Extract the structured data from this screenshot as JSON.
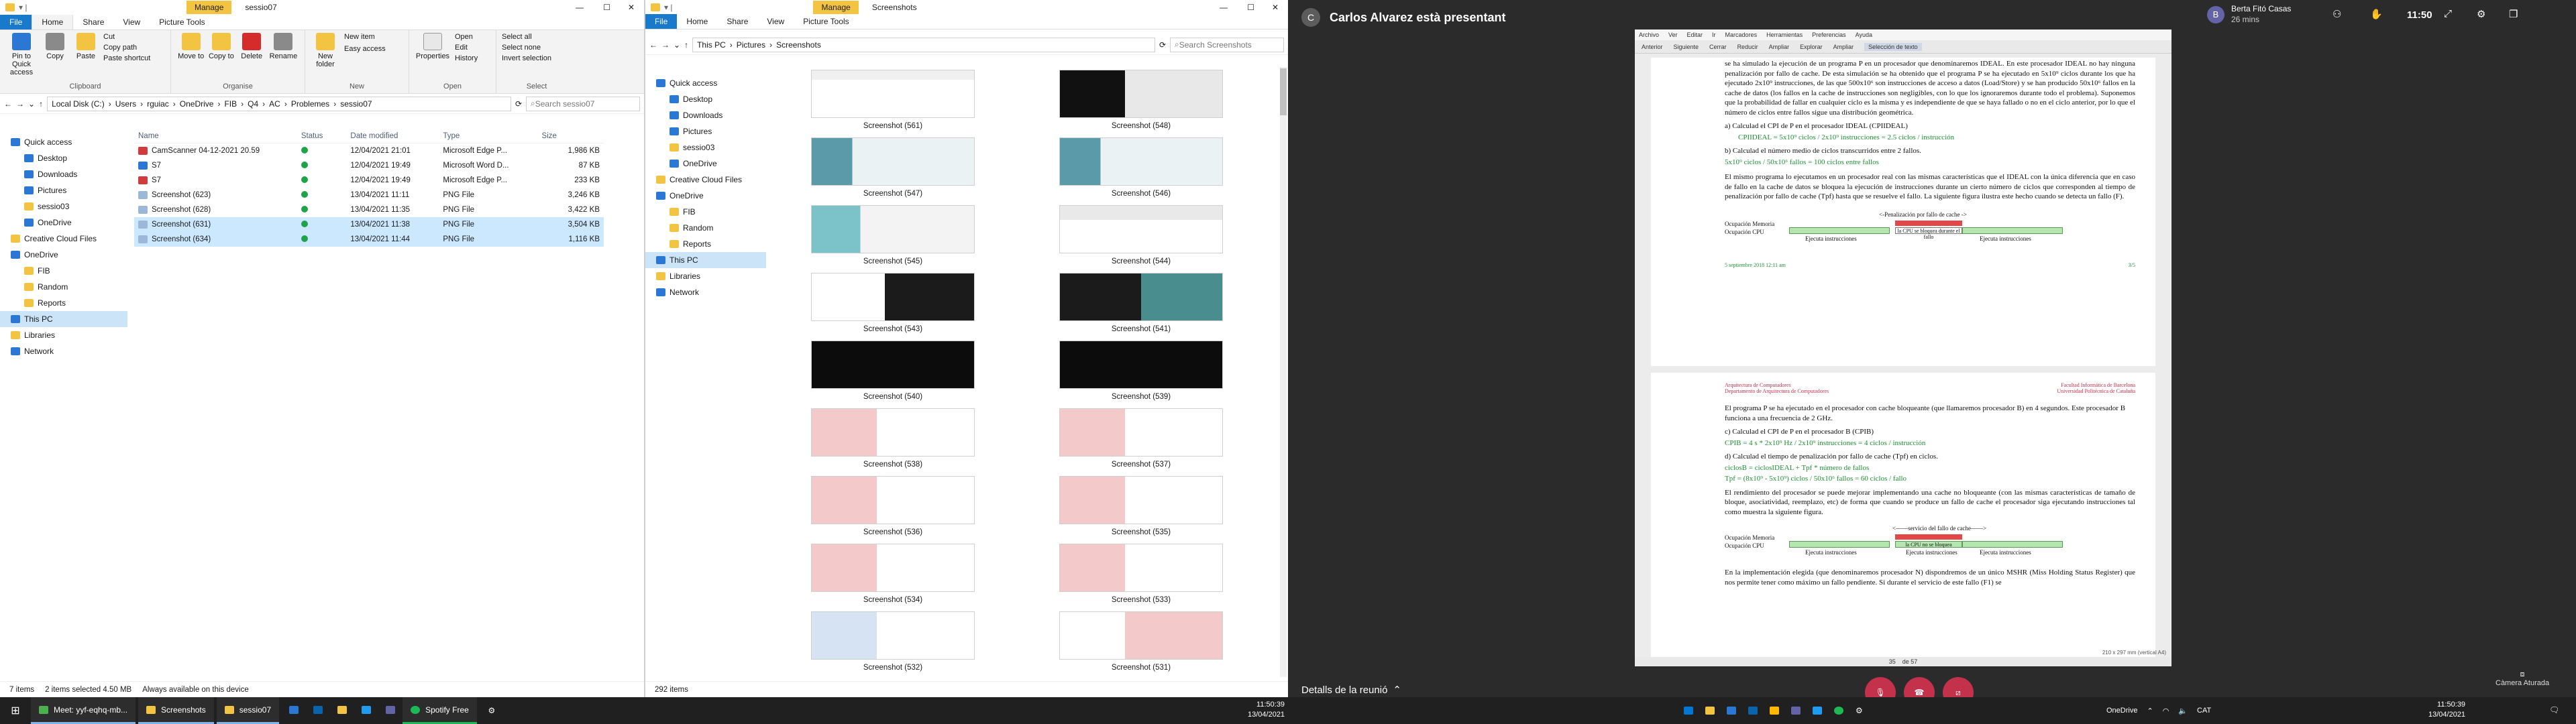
{
  "left_explorer": {
    "title": "sessio07",
    "manage_tab": "Manage",
    "tabs": [
      "File",
      "Home",
      "Share",
      "View",
      "Picture Tools"
    ],
    "ribbon": {
      "pin": "Pin to Quick access",
      "copy": "Copy",
      "paste": "Paste",
      "cut": "Cut",
      "copy_path": "Copy path",
      "paste_shortcut": "Paste shortcut",
      "move_to": "Move to",
      "copy_to": "Copy to",
      "delete": "Delete",
      "rename": "Rename",
      "new_folder": "New folder",
      "new_item": "New item",
      "easy_access": "Easy access",
      "properties": "Properties",
      "open": "Open",
      "edit": "Edit",
      "history": "History",
      "select_all": "Select all",
      "select_none": "Select none",
      "invert_selection": "Invert selection",
      "groups": [
        "Clipboard",
        "Organise",
        "New",
        "Open",
        "Select"
      ]
    },
    "address": [
      "Local Disk (C:)",
      "Users",
      "rguiac",
      "OneDrive",
      "FIB",
      "Q4",
      "AC",
      "Problemes",
      "sessio07"
    ],
    "search_placeholder": "Search sessio07",
    "nav": [
      "Quick access",
      "Desktop",
      "Downloads",
      "Pictures",
      "sessio03",
      "OneDrive",
      "Creative Cloud Files",
      "OneDrive",
      "FIB",
      "Random",
      "Reports",
      "This PC",
      "Libraries",
      "Network"
    ],
    "columns": [
      "Name",
      "Status",
      "Date modified",
      "Type",
      "Size"
    ],
    "files": [
      {
        "name": "CamScanner 04-12-2021 20.59",
        "date": "12/04/2021 21:01",
        "type": "Microsoft Edge P...",
        "size": "1,986 KB",
        "icon": "pdf"
      },
      {
        "name": "S7",
        "date": "12/04/2021 19:49",
        "type": "Microsoft Word D...",
        "size": "87 KB",
        "icon": "word"
      },
      {
        "name": "S7",
        "date": "12/04/2021 19:49",
        "type": "Microsoft Edge P...",
        "size": "233 KB",
        "icon": "pdf"
      },
      {
        "name": "Screenshot (623)",
        "date": "13/04/2021 11:11",
        "type": "PNG File",
        "size": "3,246 KB",
        "icon": "png"
      },
      {
        "name": "Screenshot (628)",
        "date": "13/04/2021 11:35",
        "type": "PNG File",
        "size": "3,422 KB",
        "icon": "png"
      },
      {
        "name": "Screenshot (631)",
        "date": "13/04/2021 11:38",
        "type": "PNG File",
        "size": "3,504 KB",
        "icon": "png",
        "selected": true
      },
      {
        "name": "Screenshot (634)",
        "date": "13/04/2021 11:44",
        "type": "PNG File",
        "size": "1,116 KB",
        "icon": "png",
        "selected": true
      }
    ],
    "status": [
      "7 items",
      "2 items selected 4.50 MB",
      "Always available on this device"
    ]
  },
  "mid_explorer": {
    "title": "Screenshots",
    "manage_tab": "Manage",
    "tabs": [
      "File",
      "Home",
      "Share",
      "View",
      "Picture Tools"
    ],
    "address": [
      "This PC",
      "Pictures",
      "Screenshots"
    ],
    "search_placeholder": "Search Screenshots",
    "nav": [
      "Quick access",
      "Desktop",
      "Downloads",
      "Pictures",
      "sessio03",
      "OneDrive",
      "Creative Cloud Files",
      "OneDrive",
      "FIB",
      "Random",
      "Reports",
      "This PC",
      "Libraries",
      "Network"
    ],
    "thumbs": [
      "Screenshot (561)",
      "Screenshot (548)",
      "Screenshot (547)",
      "Screenshot (546)",
      "Screenshot (545)",
      "Screenshot (544)",
      "Screenshot (543)",
      "Screenshot (541)",
      "Screenshot (540)",
      "Screenshot (539)",
      "Screenshot (538)",
      "Screenshot (537)",
      "Screenshot (536)",
      "Screenshot (535)",
      "Screenshot (534)",
      "Screenshot (533)",
      "Screenshot (532)",
      "Screenshot (531)"
    ],
    "status": "292 items"
  },
  "teams": {
    "avatar_letter": "C",
    "presenter": "Carlos Alvarez està presentant",
    "participant_letter": "B",
    "participant_name": "Berta Fitó Casas",
    "participant_time": "26 mins",
    "time": "11:50",
    "leave": "Surt",
    "meeting_details": "Detalls de la reunió",
    "camera_tip": "Càmera Aturada",
    "doc_menu": [
      "Archivo",
      "Ver",
      "Editar",
      "Ir",
      "Marcadores",
      "Herramientas",
      "Preferencias",
      "Ayuda"
    ],
    "doc_tools": [
      "Anterior",
      "Siguiente",
      "Cerrar",
      "Reducir",
      "Ampliar",
      "Explorar",
      "Ampliar",
      "Selección de texto"
    ],
    "doc": {
      "p1": "se ha simulado la ejecución de un programa P en un procesador que denominaremos IDEAL. En este procesador IDEAL no hay ninguna penalización por fallo de cache. De esta simulación se ha obtenido que el programa P se ha ejecutado en 5x10⁹ ciclos durante los que ha ejecutado 2x10⁹ instrucciones, de las que 500x10⁶ son instrucciones de acceso a datos (Load/Store) y se han producido 50x10⁶ fallos en la cache de datos (los fallos en la cache de instrucciones son negligibles, con lo que los ignoraremos durante todo el problema). Suponemos que la probabilidad de fallar en cualquier ciclo es la misma y es independiente de que se haya fallado o no en el ciclo anterior, por lo que el número de ciclos entre fallos sigue una distribución geométrica.",
      "qa": "a)   Calculad el CPI de P en el procesador IDEAL (CPIIDEAL)",
      "qa_ans": "CPIIDEAL = 5x10⁹ ciclos / 2x10⁹ instrucciones = 2.5 ciclos / instrucción",
      "qb": "b)   Calculad el número medio de ciclos transcurridos entre 2 fallos.",
      "qb_ans": "5x10⁹ ciclos / 50x10⁶ fallos = 100 ciclos entre fallos",
      "p2": "El mismo programa lo ejecutamos en un procesador real con las mismas características que el IDEAL con la única diferencia que en caso de fallo en la cache de datos se bloquea la ejecución de instrucciones durante un cierto número de ciclos que corresponden al tiempo de penalización por fallo de cache (Tpf) hasta que se resuelve el fallo. La siguiente figura ilustra este hecho cuando se detecta un fallo (F).",
      "fig1_top": "<-Penalización por fallo de cache ->",
      "fig1_mem": "Ocupación Memoria",
      "fig1_cpu": "Ocupación CPU",
      "fig1_exec": "Ejecuta instrucciones",
      "fig1_block": "la CPU se bloquea durante el fallo",
      "foot_left": "5 septiembre 2018 12:11 am",
      "foot_right": "3/5",
      "head_l1": "Arquitectura de Computadores",
      "head_l2": "Departamento de Arquitectura de Computadores",
      "head_r1": "Facultad Informática de Barcelona",
      "head_r2": "Universidad Politécnica de Cataluña",
      "p3": "El programa P se ha ejecutado en el procesador con cache bloqueante (que llamaremos procesador B) en 4 segundos. Este procesador B funciona a una frecuencia de 2 GHz.",
      "qc": "c)   Calculad el CPI de P en el procesador B (CPIB)",
      "qc_ans": "CPIB = 4 s * 2x10⁹ Hz / 2x10⁹ instrucciones = 4 ciclos / instrucción",
      "qd": "d)   Calculad el tiempo de penalización por fallo de cache (Tpf) en ciclos.",
      "qd_ans1": "ciclosB = ciclosIDEAL + Tpf * número de fallos",
      "qd_ans2": "Tpf = (8x10⁹ - 5x10⁹) ciclos / 50x10⁶ fallos = 60 ciclos / fallo",
      "p4": "El rendimiento del procesador se puede mejorar implementando una cache no bloqueante (con las mismas características de tamaño de bloque, asociatividad, reemplazo, etc) de forma que cuando se produce un fallo de cache el procesador siga ejecutando instrucciones tal como muestra la siguiente figura.",
      "fig2_top": "<——servicio del fallo de cache——>",
      "fig2_block": "la CPU no se bloquea",
      "p5": "En la implementación elegida (que denominaremos procesador N) dispondremos de un único MSHR (Miss Holding Status Register) que nos permite tener como máximo un fallo pendiente. Si durante el servicio de este fallo (F1) se",
      "page_info": "210 x 297 mm (vertical A4)",
      "page_num": "35",
      "page_of": "de 57"
    }
  },
  "taskbar": {
    "apps": [
      "Meet: yyf-eqhq-mb...",
      "Screenshots",
      "sessio07",
      "Spotify Free"
    ],
    "time_left": "11:50:39",
    "date_left": "13/04/2021",
    "onedrive": "OneDrive",
    "lang": "CAT",
    "time_right": "11:50:39",
    "date_right": "13/04/2021"
  },
  "colors": {
    "accent": "#1979ca",
    "selection": "#cce8ff",
    "teams_red": "#c4314b",
    "bar_red": "#e24848",
    "bar_green": "#b6e6b0"
  }
}
